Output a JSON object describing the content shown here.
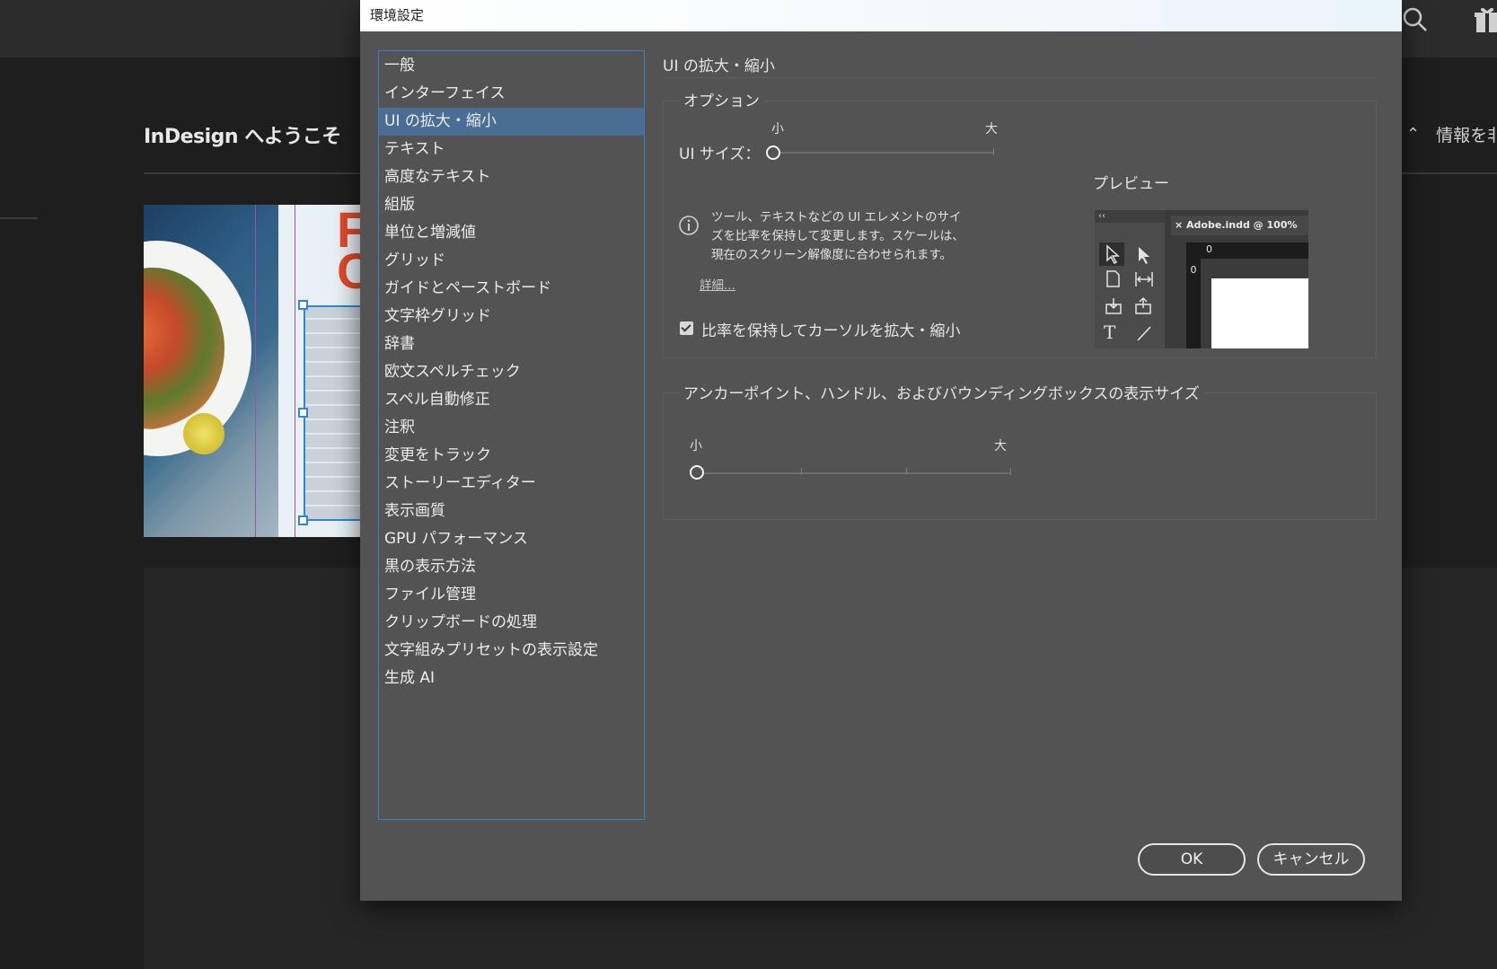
{
  "background": {
    "welcome_title": "InDesign へようこそ",
    "thumbnail_text": "F\nCU",
    "info_toggle_label": "情報を非"
  },
  "dialog": {
    "title": "環境設定",
    "categories": [
      "一般",
      "インターフェイス",
      "UI の拡大・縮小",
      "テキスト",
      "高度なテキスト",
      "組版",
      "単位と増減値",
      "グリッド",
      "ガイドとペーストボード",
      "文字枠グリッド",
      "辞書",
      "欧文スペルチェック",
      "スペル自動修正",
      "注釈",
      "変更をトラック",
      "ストーリーエディター",
      "表示画質",
      "GPU パフォーマンス",
      "黒の表示方法",
      "ファイル管理",
      "クリップボードの処理",
      "文字組みプリセットの表示設定",
      "生成 AI"
    ],
    "selected_category": "UI の拡大・縮小",
    "panel_title": "UI の拡大・縮小",
    "options_group": {
      "title": "オプション",
      "ui_size_label": "UI サイズ：",
      "slider_min": "小",
      "slider_max": "大",
      "ui_size_value": 0,
      "preview_label": "プレビュー",
      "info_text_line1": "ツール、テキストなどの UI エレメントのサイ",
      "info_text_line2": "ズを比率を保持して変更します。スケールは、",
      "info_text_line3": "現在のスクリーン解像度に合わせられます。",
      "more_link": "詳細...",
      "scale_cursor_label": "比率を保持してカーソルを拡大・縮小",
      "scale_cursor_checked": true
    },
    "preview_thumb": {
      "collapse": "‹‹",
      "tab_label": "× Adobe.indd @ 100%",
      "ruler_h_zero": "0",
      "ruler_v_zero": "0"
    },
    "anchor_group": {
      "title": "アンカーポイント、ハンドル、およびバウンディングボックスの表示サイズ",
      "slider_min": "小",
      "slider_max": "大",
      "value": 0
    },
    "ok_label": "OK",
    "cancel_label": "キャンセル"
  }
}
